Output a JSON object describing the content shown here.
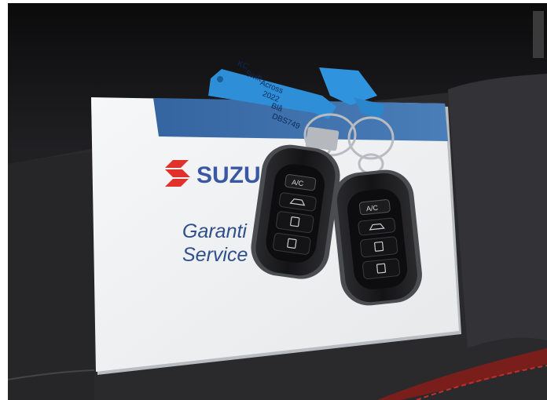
{
  "photo": {
    "booklet": {
      "brand_text": "SUZU",
      "line1": "Garanti",
      "line2": "Service"
    },
    "tag": {
      "handwriting": [
        "KC",
        "Swift",
        "Across",
        "2022",
        "Blå",
        "DBS749"
      ]
    },
    "fob_left": {
      "ac_label": "A/C"
    },
    "fob_right": {
      "ac_label": "A/C"
    },
    "colors": {
      "seat": "#2b2b2e",
      "booklet": "#f2f3f4",
      "booklet_band": "#3d6fa7",
      "brand_red": "#e0322b",
      "brand_blue": "#3a57a3",
      "tag": "#2e8fd8",
      "fob": "#1a1a1c",
      "stitching": "#c0302b"
    }
  }
}
